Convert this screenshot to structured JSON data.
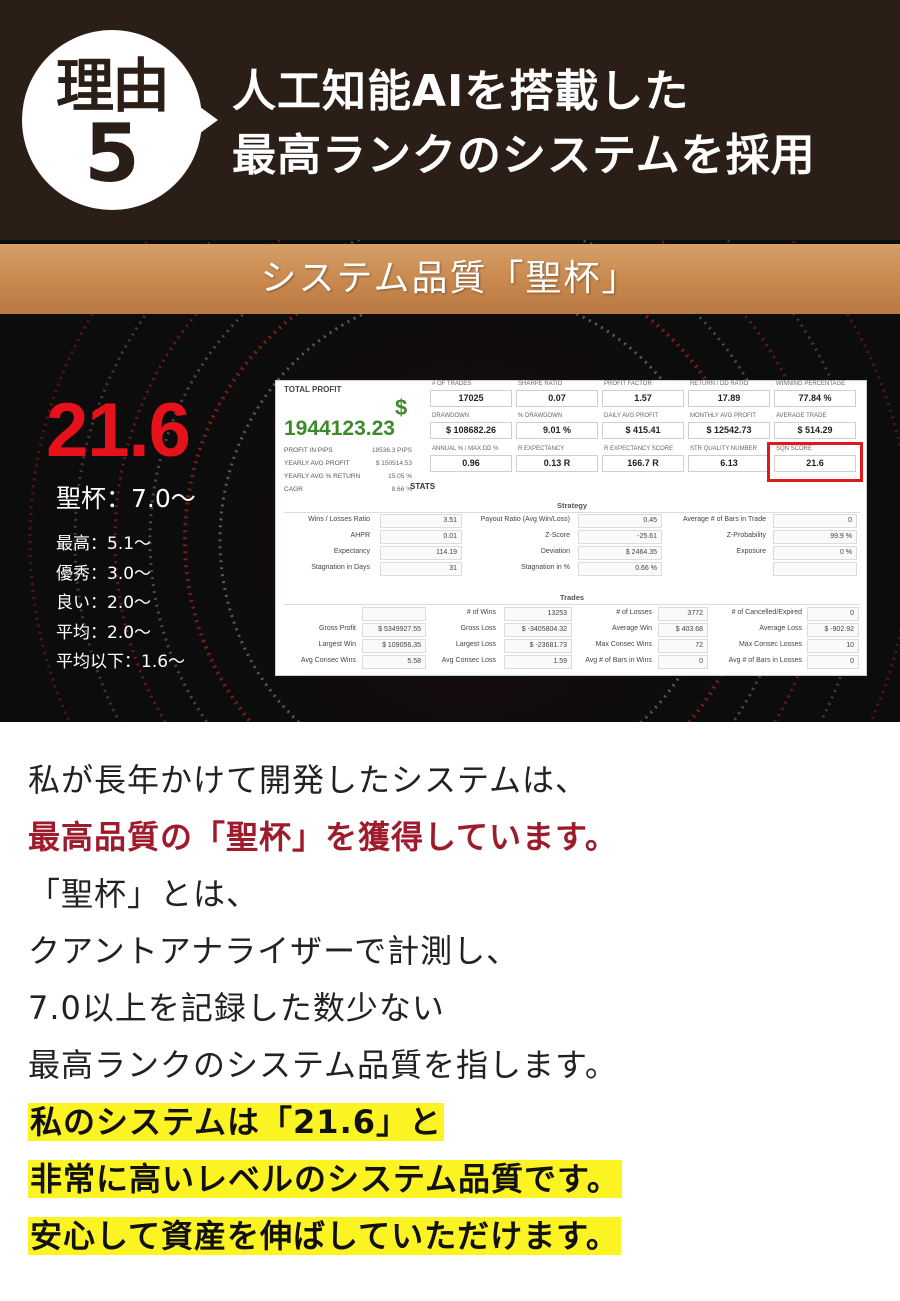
{
  "header": {
    "badge_top": "理由",
    "badge_number": "5",
    "line1": "人工知能AIを搭載した",
    "line2": "最高ランクのシステムを採用"
  },
  "panel": {
    "banner_title": "システム品質「聖杯」",
    "score": "21.6",
    "grade_main": "聖杯：7.0〜",
    "grades": [
      "最高：5.1〜",
      "優秀：3.0〜",
      "良い：2.0〜",
      "平均：2.0〜",
      "平均以下：1.6〜"
    ]
  },
  "report": {
    "total_profit_label": "TOTAL PROFIT",
    "dollar": "$",
    "total_profit_value": "1944123.23",
    "side_rows": [
      {
        "label": "PROFIT IN PIPS",
        "value": "18536.3 PIPS"
      },
      {
        "label": "YEARLY AVG PROFIT",
        "value": "$ 150514.53"
      },
      {
        "label": "YEARLY AVG % RETURN",
        "value": "15.05 %"
      },
      {
        "label": "CAGR",
        "value": "8.66 %"
      }
    ],
    "metrics": [
      {
        "label": "# OF TRADES",
        "value": "17025"
      },
      {
        "label": "SHARPE RATIO",
        "value": "0.07"
      },
      {
        "label": "PROFIT FACTOR",
        "value": "1.57"
      },
      {
        "label": "RETURN / DD RATIO",
        "value": "17.89"
      },
      {
        "label": "WINNING PERCENTAGE",
        "value": "77.84 %"
      },
      {
        "label": "DRAWDOWN",
        "value": "$ 108682.26"
      },
      {
        "label": "% DRAWDOWN",
        "value": "9.01 %"
      },
      {
        "label": "DAILY AVG PROFIT",
        "value": "$ 415.41"
      },
      {
        "label": "MONTHLY AVG PROFIT",
        "value": "$ 12542.73"
      },
      {
        "label": "AVERAGE TRADE",
        "value": "$ 514.29"
      },
      {
        "label": "ANNUAL % / MAX DD %",
        "value": "0.96"
      },
      {
        "label": "R EXPECTANCY",
        "value": "0.13 R"
      },
      {
        "label": "R EXPECTANCY SCORE",
        "value": "166.7 R"
      },
      {
        "label": "STR QUALITY NUMBER",
        "value": "6.13"
      },
      {
        "label": "SQN SCORE",
        "value": "21.6"
      }
    ],
    "stats_label": "STATS",
    "strategy_title": "Strategy",
    "strategy_rows": [
      [
        {
          "label": "Wins / Losses Ratio",
          "value": "3.51"
        },
        {
          "label": "Payout Ratio (Avg Win/Loss)",
          "value": "0.45"
        },
        {
          "label": "Average # of Bars in Trade",
          "value": "0"
        }
      ],
      [
        {
          "label": "AHPR",
          "value": "0.01"
        },
        {
          "label": "Z-Score",
          "value": "-25.61"
        },
        {
          "label": "Z-Probability",
          "value": "99.9 %"
        }
      ],
      [
        {
          "label": "Expectancy",
          "value": "114.19"
        },
        {
          "label": "Deviation",
          "value": "$ 2464.35"
        },
        {
          "label": "Exposure",
          "value": "0 %"
        }
      ],
      [
        {
          "label": "Stagnation in Days",
          "value": "31"
        },
        {
          "label": "Stagnation in %",
          "value": "0.66 %"
        },
        {
          "label": "",
          "value": ""
        }
      ]
    ],
    "trades_title": "Trades",
    "trades_rows": [
      [
        {
          "label": "",
          "value": ""
        },
        {
          "label": "# of Wins",
          "value": "13253"
        },
        {
          "label": "# of Losses",
          "value": "3772"
        },
        {
          "label": "# of Cancelled/Expired",
          "value": "0"
        }
      ],
      [
        {
          "label": "Gross Profit",
          "value": "$ 5349927.55"
        },
        {
          "label": "Gross Loss",
          "value": "$ -3405804.32"
        },
        {
          "label": "Average Win",
          "value": "$ 403.68"
        },
        {
          "label": "Average Loss",
          "value": "$ -902.92"
        }
      ],
      [
        {
          "label": "Largest Win",
          "value": "$ 109056.35"
        },
        {
          "label": "Largest Loss",
          "value": "$ -23681.73"
        },
        {
          "label": "Max Consec Wins",
          "value": "72"
        },
        {
          "label": "Max Consec Losses",
          "value": "10"
        }
      ],
      [
        {
          "label": "Avg Consec Wins",
          "value": "5.58"
        },
        {
          "label": "Avg Consec Loss",
          "value": "1.59"
        },
        {
          "label": "Avg # of Bars in Wins",
          "value": "0"
        },
        {
          "label": "Avg # of Bars in Losses",
          "value": "0"
        }
      ]
    ]
  },
  "body": {
    "line1": "私が長年かけて開発したシステムは、",
    "line2": "最高品質の「聖杯」を獲得しています。",
    "line3": "「聖杯」とは、",
    "line4": "クアントアナライザーで計測し、",
    "line5": "7.0以上を記録した数少ない",
    "line6": "最高ランクのシステム品質を指します。",
    "line7": "私のシステムは「21.6」と",
    "line8": "非常に高いレベルのシステム品質です。",
    "line9": "安心して資産を伸ばしていただけます。"
  },
  "colors": {
    "header_bg": "#2a1e17",
    "banner": "#c8874d",
    "score_red": "#e6121b",
    "profit_green": "#3d8a2a",
    "emphasis_red": "#9e1b2c",
    "highlight_yellow": "#fcf322"
  }
}
